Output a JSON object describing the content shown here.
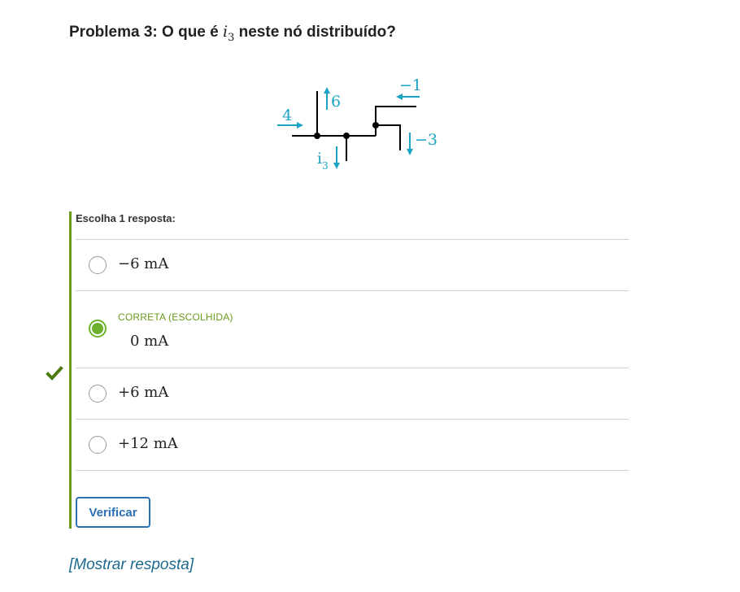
{
  "problem": {
    "title_prefix": "Problema 3: O que é ",
    "title_math_var": "i",
    "title_math_sub": "3",
    "title_suffix": " neste nó distribuído?"
  },
  "diagram": {
    "label_in_left": "4",
    "label_up": "6",
    "label_top_right": "−1",
    "label_down_right": "−3",
    "label_i": "i",
    "label_i_sub": "3",
    "arrow_color": "#1ba3c6"
  },
  "quiz": {
    "prompt": "Escolha 1 resposta:",
    "accent_color": "#6a9a19",
    "options": [
      {
        "text": "−6 mA",
        "selected": false
      },
      {
        "text": "0 mA",
        "selected": true,
        "status": "CORRETA (ESCOLHIDA)"
      },
      {
        "text": "+6 mA",
        "selected": false
      },
      {
        "text": "+12 mA",
        "selected": false
      }
    ],
    "verify_label": "Verificar",
    "show_answer_label": "[Mostrar resposta]"
  }
}
